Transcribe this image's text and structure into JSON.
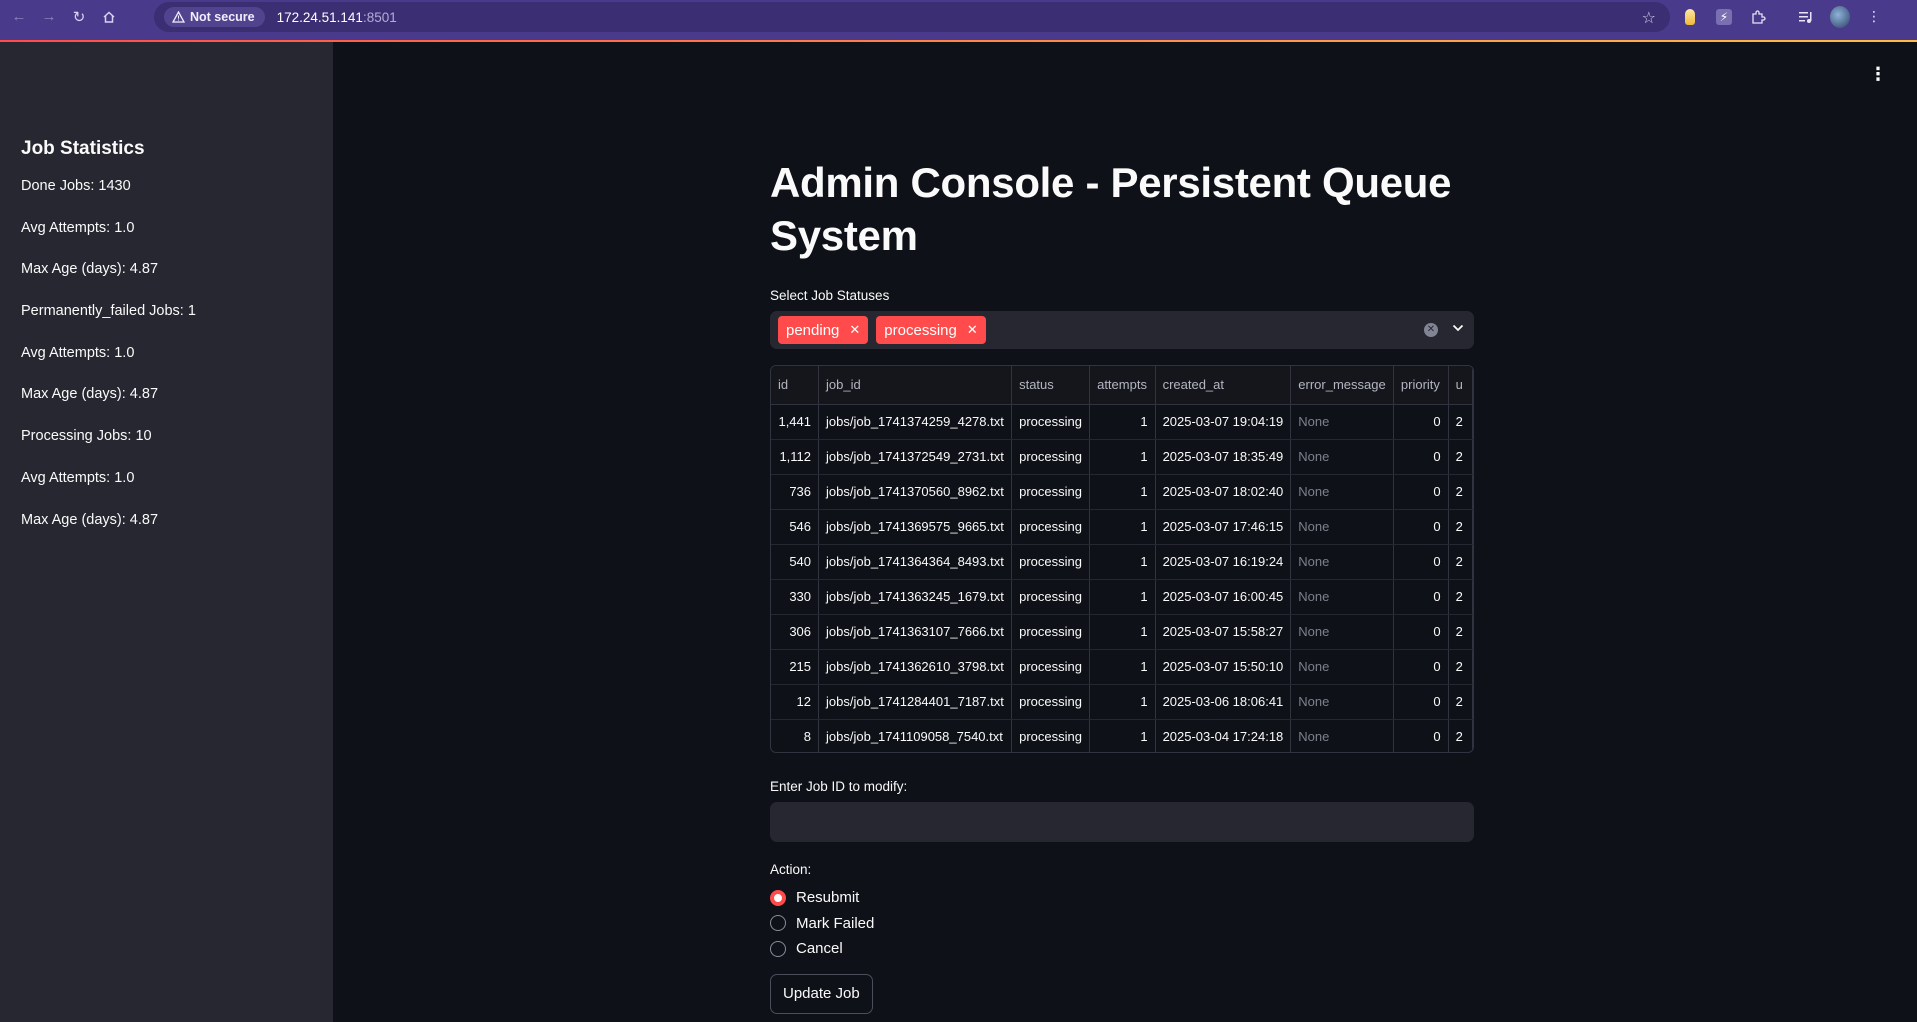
{
  "browser": {
    "security_label": "Not secure",
    "url_host": "172.24.51.141",
    "url_port": ":8501"
  },
  "sidebar": {
    "heading": "Job Statistics",
    "stats": [
      "Done Jobs: 1430",
      "Avg Attempts: 1.0",
      "Max Age (days): 4.87",
      "Permanently_failed Jobs: 1",
      "Avg Attempts: 1.0",
      "Max Age (days): 4.87",
      "Processing Jobs: 10",
      "Avg Attempts: 1.0",
      "Max Age (days): 4.87"
    ]
  },
  "main": {
    "title": "Admin Console - Persistent Queue System",
    "status_select": {
      "label": "Select Job Statuses",
      "chips": [
        "pending",
        "processing"
      ]
    },
    "table": {
      "columns": [
        "id",
        "job_id",
        "status",
        "attempts",
        "created_at",
        "error_message",
        "priority",
        "u"
      ],
      "rows": [
        [
          "1,441",
          "jobs/job_1741374259_4278.txt",
          "processing",
          "1",
          "2025-03-07 19:04:19",
          "None",
          "0",
          "2"
        ],
        [
          "1,112",
          "jobs/job_1741372549_2731.txt",
          "processing",
          "1",
          "2025-03-07 18:35:49",
          "None",
          "0",
          "2"
        ],
        [
          "736",
          "jobs/job_1741370560_8962.txt",
          "processing",
          "1",
          "2025-03-07 18:02:40",
          "None",
          "0",
          "2"
        ],
        [
          "546",
          "jobs/job_1741369575_9665.txt",
          "processing",
          "1",
          "2025-03-07 17:46:15",
          "None",
          "0",
          "2"
        ],
        [
          "540",
          "jobs/job_1741364364_8493.txt",
          "processing",
          "1",
          "2025-03-07 16:19:24",
          "None",
          "0",
          "2"
        ],
        [
          "330",
          "jobs/job_1741363245_1679.txt",
          "processing",
          "1",
          "2025-03-07 16:00:45",
          "None",
          "0",
          "2"
        ],
        [
          "306",
          "jobs/job_1741363107_7666.txt",
          "processing",
          "1",
          "2025-03-07 15:58:27",
          "None",
          "0",
          "2"
        ],
        [
          "215",
          "jobs/job_1741362610_3798.txt",
          "processing",
          "1",
          "2025-03-07 15:50:10",
          "None",
          "0",
          "2"
        ],
        [
          "12",
          "jobs/job_1741284401_7187.txt",
          "processing",
          "1",
          "2025-03-06 18:06:41",
          "None",
          "0",
          "2"
        ],
        [
          "8",
          "jobs/job_1741109058_7540.txt",
          "processing",
          "1",
          "2025-03-04 17:24:18",
          "None",
          "0",
          "2"
        ]
      ]
    },
    "job_id_input": {
      "label": "Enter Job ID to modify:",
      "value": "",
      "placeholder": ""
    },
    "action": {
      "label": "Action:",
      "options": [
        "Resubmit",
        "Mark Failed",
        "Cancel"
      ],
      "selected": "Resubmit"
    },
    "update_button": "Update Job"
  },
  "colors": {
    "accent": "#ff4b4b",
    "background": "#0e1117",
    "sidebar": "#262730",
    "browser_frame": "#4a3a8c"
  }
}
